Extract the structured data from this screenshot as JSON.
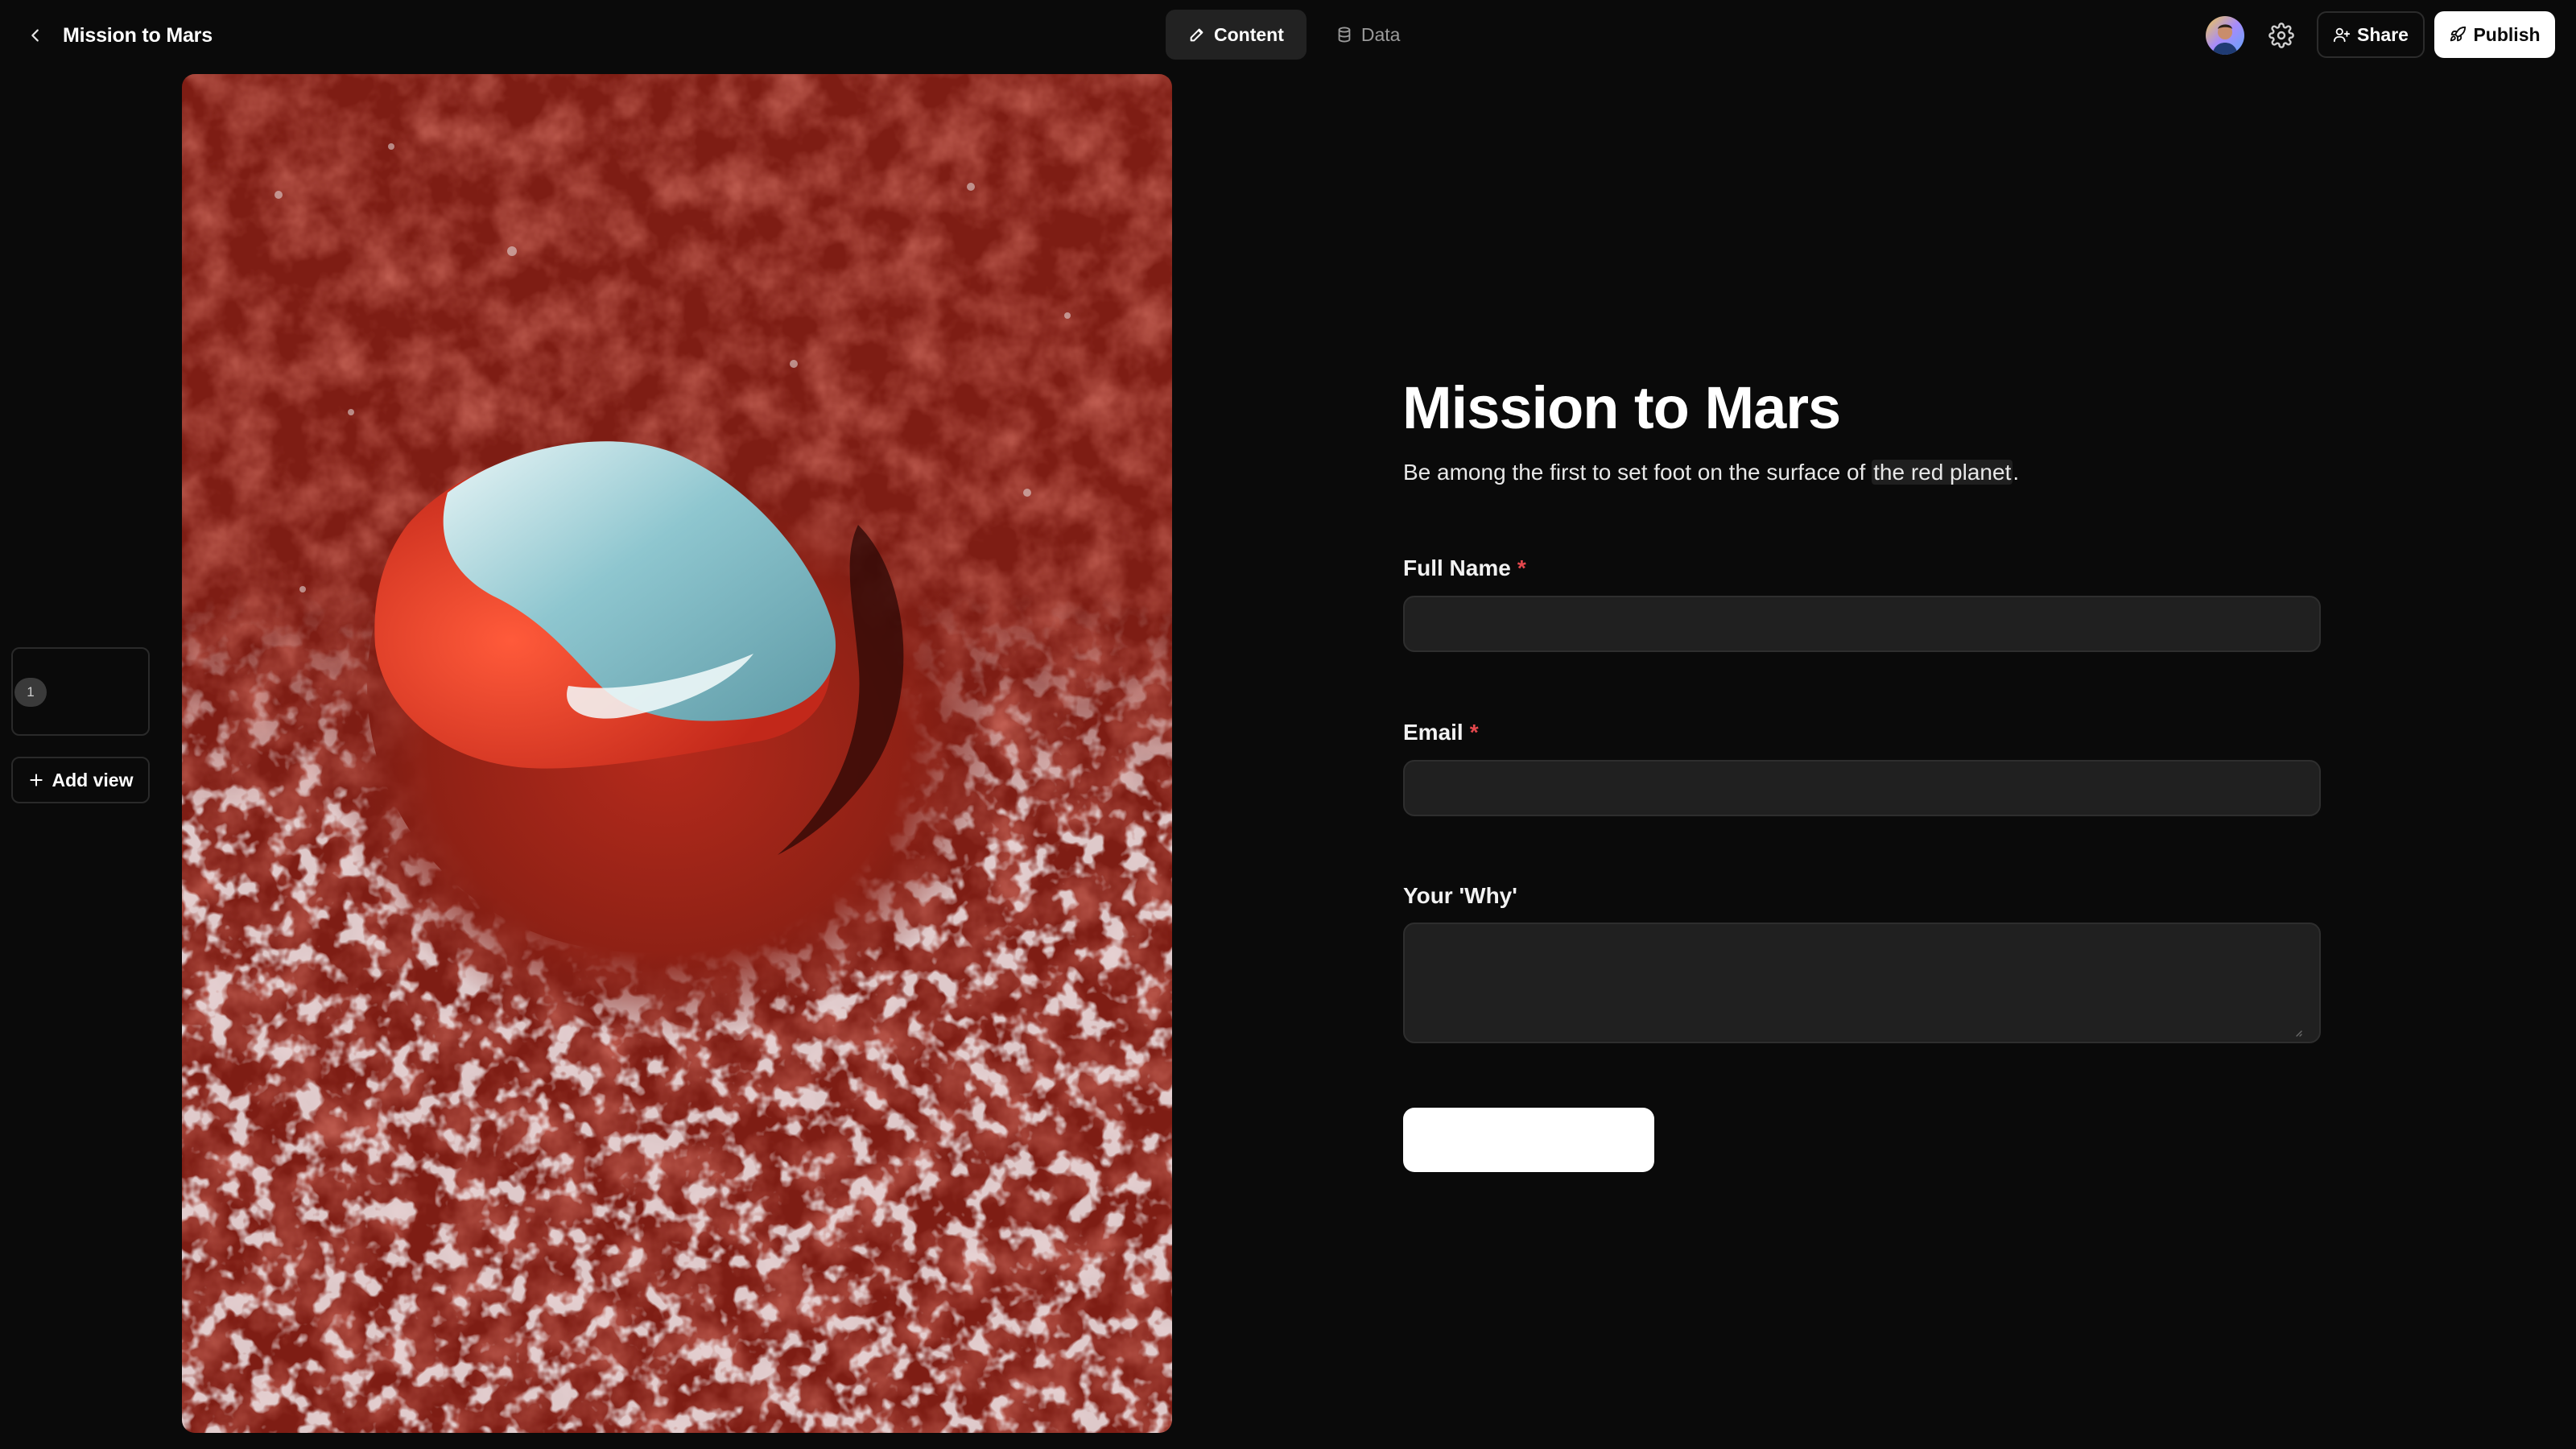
{
  "header": {
    "title": "Mission to Mars",
    "tabs": [
      {
        "label": "Content",
        "icon": "pencil-icon",
        "active": true
      },
      {
        "label": "Data",
        "icon": "database-icon",
        "active": false
      }
    ],
    "share_label": "Share",
    "publish_label": "Publish"
  },
  "views": {
    "items": [
      {
        "number": "1"
      }
    ],
    "add_label": "Add view"
  },
  "form": {
    "title": "Mission to Mars",
    "subtitle_before": "Be among the first to set foot on the surface of ",
    "subtitle_highlight": "the red planet",
    "subtitle_after": ".",
    "fields": [
      {
        "label": "Full Name",
        "required_mark": "*",
        "value": "",
        "type": "text"
      },
      {
        "label": "Email",
        "required_mark": "*",
        "value": "",
        "type": "email"
      },
      {
        "label": "Your 'Why'",
        "value": "",
        "type": "textarea"
      }
    ],
    "submit_label": ""
  },
  "colors": {
    "background": "#0a0a0a",
    "input_bg": "#202020",
    "required": "#e5484d",
    "mars_red": "#8a1f16",
    "ice": "#7fb8c2"
  }
}
